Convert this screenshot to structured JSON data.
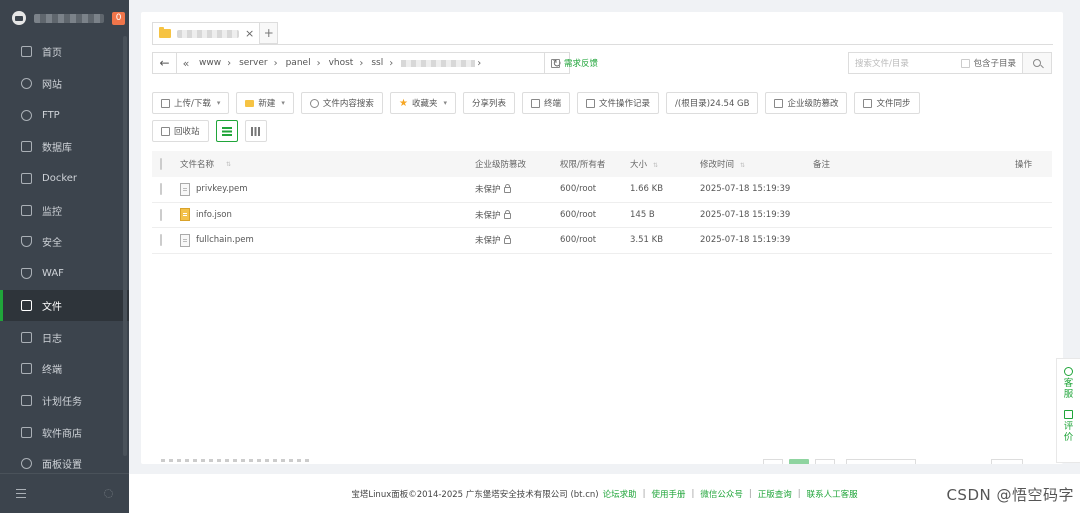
{
  "sidebar": {
    "badge": "0",
    "items": [
      {
        "label": "首页",
        "icon": "home-icon"
      },
      {
        "label": "网站",
        "icon": "globe-icon"
      },
      {
        "label": "FTP",
        "icon": "ftp-icon"
      },
      {
        "label": "数据库",
        "icon": "database-icon"
      },
      {
        "label": "Docker",
        "icon": "docker-icon"
      },
      {
        "label": "监控",
        "icon": "monitor-icon"
      },
      {
        "label": "安全",
        "icon": "shield-icon"
      },
      {
        "label": "WAF",
        "icon": "waf-icon"
      },
      {
        "label": "文件",
        "icon": "folder-icon",
        "active": true
      },
      {
        "label": "日志",
        "icon": "log-icon"
      },
      {
        "label": "终端",
        "icon": "terminal-icon"
      },
      {
        "label": "计划任务",
        "icon": "clock-icon"
      },
      {
        "label": "软件商店",
        "icon": "store-icon"
      },
      {
        "label": "面板设置",
        "icon": "gear-icon"
      }
    ]
  },
  "tabs": {
    "add_label": "+",
    "close_label": "×"
  },
  "path": {
    "back_label": "←",
    "double_chevron": "«",
    "separator": "›",
    "refresh_label": "↻",
    "segments": [
      "www",
      "server",
      "panel",
      "vhost",
      "ssl"
    ]
  },
  "feedback_label": "需求反馈",
  "search": {
    "placeholder": "搜索文件/目录",
    "subdir_label": "包含子目录"
  },
  "toolbar": {
    "upload": "上传/下载",
    "new": "新建",
    "content_search": "文件内容搜索",
    "favorites": "收藏夹",
    "share_list": "分享列表",
    "terminal": "终端",
    "file_log": "文件操作记录",
    "disk": "/(根目录)24.54 GB",
    "tamper": "企业级防篡改",
    "sync": "文件同步",
    "recycle": "回收站",
    "caret": "▾"
  },
  "table": {
    "headers": {
      "name": "文件名称",
      "protection": "企业级防篡改",
      "perm": "权限/所有者",
      "size": "大小",
      "mtime": "修改时间",
      "note": "备注",
      "action": "操作",
      "sort": "⇅"
    },
    "rows": [
      {
        "name": "privkey.pem",
        "protection": "未保护",
        "perm": "600/root",
        "size": "1.66 KB",
        "mtime": "2025-07-18 15:19:39",
        "note": "",
        "type": "file"
      },
      {
        "name": "info.json",
        "protection": "未保护",
        "perm": "600/root",
        "size": "145 B",
        "mtime": "2025-07-18 15:19:39",
        "note": "",
        "type": "json"
      },
      {
        "name": "fullchain.pem",
        "protection": "未保护",
        "perm": "600/root",
        "size": "3.51 KB",
        "mtime": "2025-07-18 15:19:39",
        "note": "",
        "type": "file"
      }
    ]
  },
  "footer": {
    "copyright": "宝塔Linux面板©2014-2025 广东堡塔安全技术有限公司 (bt.cn)",
    "links": [
      "论坛求助",
      "使用手册",
      "微信公众号",
      "正版查询",
      "联系人工客服"
    ],
    "sep": "|"
  },
  "float": {
    "service": "客服",
    "review": "评价"
  },
  "watermark": "CSDN @悟空码字",
  "colors": {
    "accent": "#20a53a",
    "sidebar_bg": "#3c444d",
    "badge": "#f0754a"
  }
}
